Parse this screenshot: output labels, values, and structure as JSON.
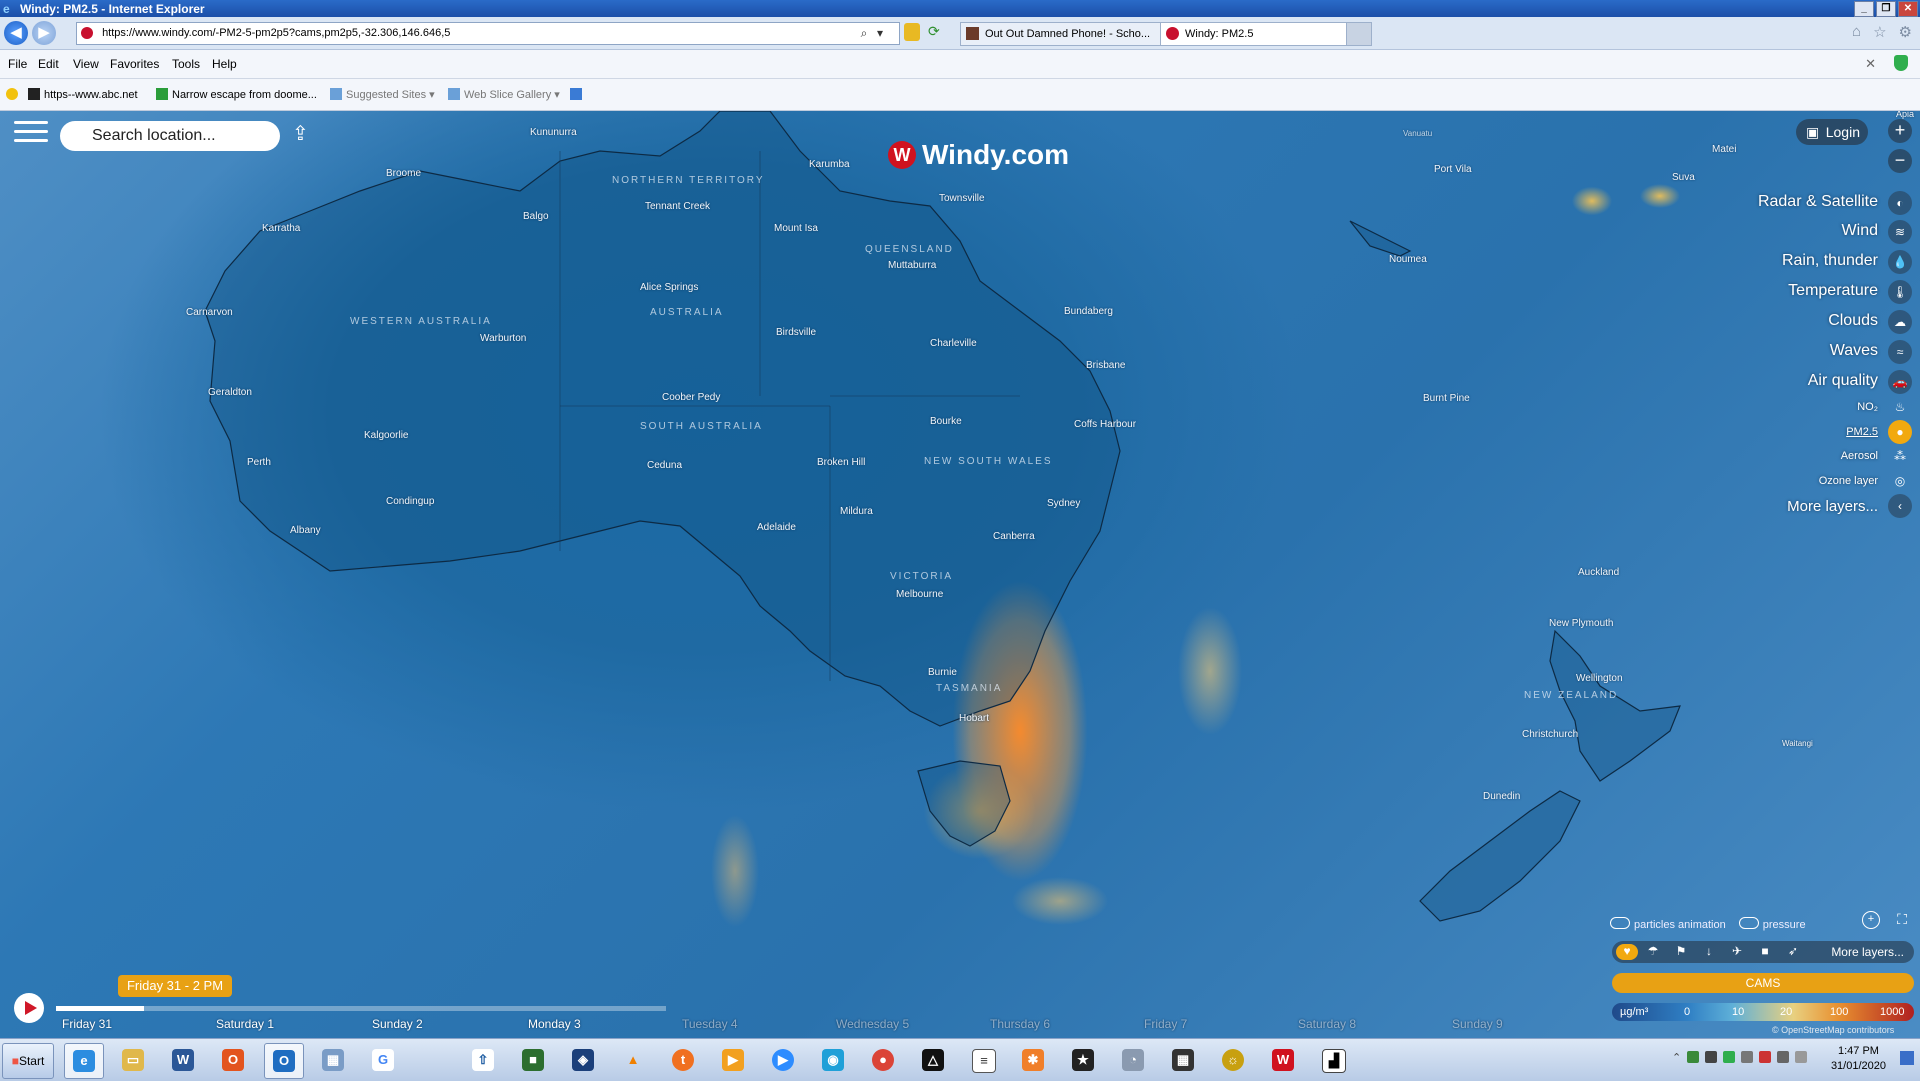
{
  "window": {
    "title": "Windy: PM2.5 - Internet Explorer"
  },
  "browser": {
    "url": "https://www.windy.com/-PM2-5-pm2p5?cams,pm2p5,-32.306,146.646,5",
    "tabs": [
      {
        "label": "Out Out Damned Phone! - Scho...",
        "active": false
      },
      {
        "label": "Windy: PM2.5",
        "active": true
      }
    ],
    "menu": [
      "File",
      "Edit",
      "View",
      "Favorites",
      "Tools",
      "Help"
    ],
    "favorites": [
      "https--www.abc.net",
      "Narrow escape from doome...",
      "Suggested Sites",
      "Web Slice Gallery"
    ]
  },
  "windy": {
    "logo": "Windy.com",
    "search_placeholder": "Search location...",
    "login": "Login",
    "layers": [
      {
        "label": "Radar & Satellite",
        "sub": false,
        "selected": false
      },
      {
        "label": "Wind",
        "sub": false,
        "selected": false
      },
      {
        "label": "Rain, thunder",
        "sub": false,
        "selected": false
      },
      {
        "label": "Temperature",
        "sub": false,
        "selected": false
      },
      {
        "label": "Clouds",
        "sub": false,
        "selected": false
      },
      {
        "label": "Waves",
        "sub": false,
        "selected": false
      },
      {
        "label": "Air quality",
        "sub": false,
        "selected": false
      },
      {
        "label": "NO₂",
        "sub": true,
        "selected": false
      },
      {
        "label": "PM2.5",
        "sub": true,
        "selected": true
      },
      {
        "label": "Aerosol",
        "sub": true,
        "selected": false
      },
      {
        "label": "Ozone layer",
        "sub": true,
        "selected": false
      },
      {
        "label": "More layers...",
        "sub": false,
        "selected": false
      }
    ],
    "particles_label": "particles animation",
    "pressure_label": "pressure",
    "overlay_more": "More layers...",
    "model": "CAMS",
    "legend": {
      "unit": "µg/m³",
      "values": [
        "0",
        "10",
        "20",
        "100",
        "1000"
      ]
    },
    "attribution": "© OpenStreetMap contributors",
    "time_bubble": "Friday 31 - 2 PM",
    "days": [
      "Friday 31",
      "Saturday 1",
      "Sunday 2",
      "Monday 3",
      "Tuesday 4",
      "Wednesday 5",
      "Thursday 6",
      "Friday 7",
      "Saturday 8",
      "Sunday 9"
    ],
    "corner_label": "Apia",
    "colors": {
      "accent": "#e8a114",
      "brand": "#d0121f"
    }
  },
  "map": {
    "cities": [
      "Kununurra",
      "Broome",
      "Karratha",
      "Balgo",
      "Tennant Creek",
      "Karumba",
      "Townsville",
      "Mount Isa",
      "Muttaburra",
      "Alice Springs",
      "Carnarvon",
      "Warburton",
      "Birdsville",
      "Charleville",
      "Bundaberg",
      "Brisbane",
      "Geraldton",
      "Coober Pedy",
      "Bourke",
      "Coffs Harbour",
      "Kalgoorlie",
      "Perth",
      "Ceduna",
      "Broken Hill",
      "Condingup",
      "Albany",
      "Sydney",
      "Mildura",
      "Adelaide",
      "Canberra",
      "Melbourne",
      "Burnie",
      "Hobart",
      "Port Vila",
      "Suva",
      "Matei",
      "Noumea",
      "Burnt Pine",
      "Auckland",
      "New Plymouth",
      "Wellington",
      "Christchurch",
      "Dunedin",
      "Vanuatu",
      "Waitangi"
    ],
    "regions": [
      "NORTHERN TERRITORY",
      "QUEENSLAND",
      "AUSTRALIA",
      "WESTERN AUSTRALIA",
      "SOUTH AUSTRALIA",
      "NEW SOUTH WALES",
      "VICTORIA",
      "TASMANIA",
      "NEW ZEALAND"
    ]
  },
  "taskbar": {
    "start": "Start",
    "time": "1:47 PM",
    "date": "31/01/2020"
  }
}
